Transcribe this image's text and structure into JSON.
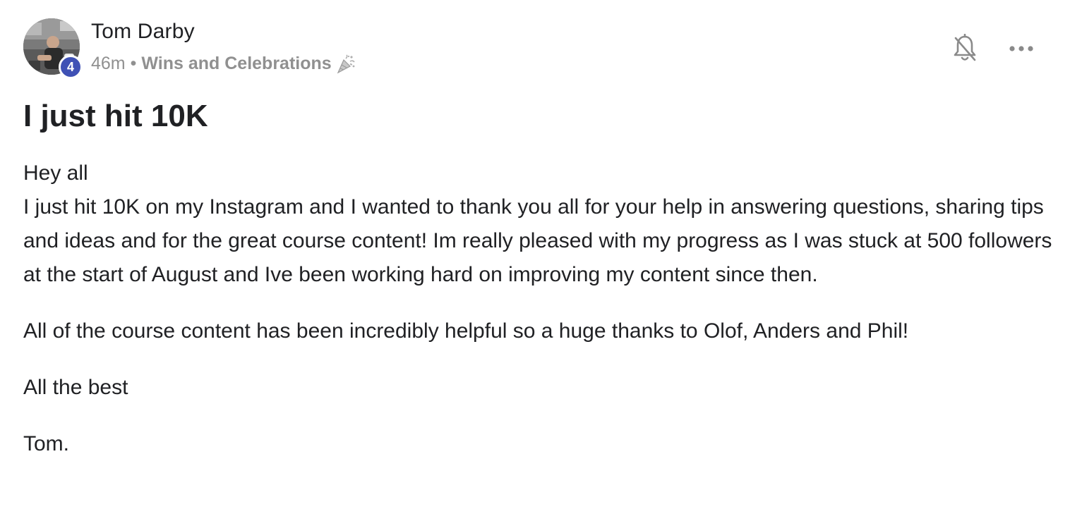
{
  "post": {
    "author": "Tom Darby",
    "level": "4",
    "time_ago": "46m",
    "separator": "•",
    "category": "Wins and Celebrations",
    "category_icon": "party-popper-icon",
    "title": "I just hit 10K",
    "body": {
      "greeting": "Hey all",
      "paragraph_1": "I just hit 10K on my Instagram and I wanted to thank you all for your help in answering questions, sharing tips and ideas and for the great course content! Im really pleased with my progress as I was stuck at 500 followers at the start of August and Ive been working hard on improving my content since then.",
      "paragraph_2": "All of the course content has been incredibly helpful so a huge thanks to Olof, Anders and Phil!",
      "paragraph_3": "All the best",
      "signoff": "Tom."
    }
  },
  "actions": {
    "notifications_icon": "bell-off-icon",
    "more_icon": "more-horizontal-icon"
  },
  "colors": {
    "badge": "#3f51b5",
    "text": "#202124",
    "muted": "#909090"
  }
}
